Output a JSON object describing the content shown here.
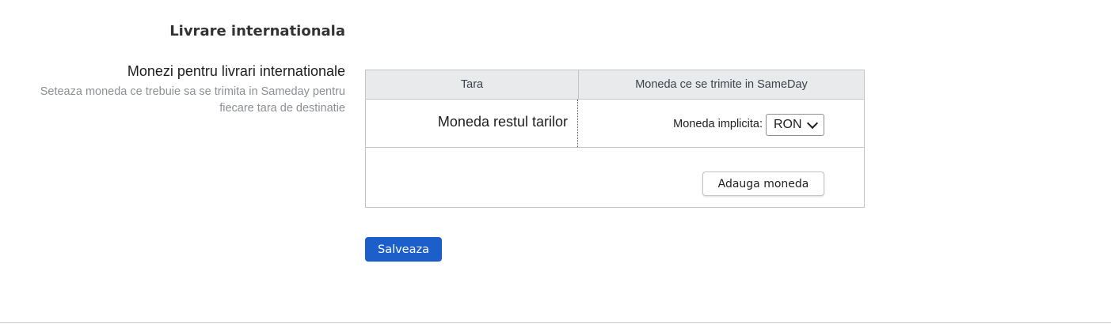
{
  "section": {
    "title": "Livrare internationala"
  },
  "field": {
    "label": "Monezi pentru livrari internationale",
    "description": "Seteaza moneda ce trebuie sa se trimita in Sameday pentru fiecare tara de destinatie"
  },
  "table": {
    "headers": {
      "country": "Tara",
      "currency": "Moneda ce se trimite in SameDay"
    },
    "rows": [
      {
        "country": "Moneda restul tarilor",
        "currency_label": "Moneda implicita:",
        "currency_value": "RON"
      }
    ],
    "add_label": "Adauga moneda"
  },
  "actions": {
    "save_label": "Salveaza"
  },
  "colors": {
    "primary": "#1c5fcb",
    "header_bg": "#e9eaeb",
    "border": "#c3c4c7",
    "muted_text": "#8c8f94"
  }
}
